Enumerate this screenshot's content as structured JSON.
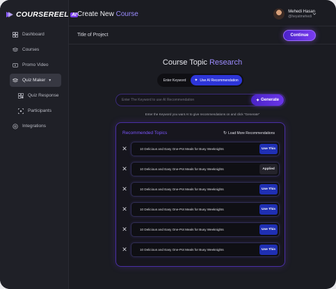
{
  "brand": {
    "name": "COURSEREEL",
    "ai_badge": "AI"
  },
  "sidebar": {
    "items": [
      {
        "label": "Dashboard",
        "icon": "grid-icon"
      },
      {
        "label": "Courses",
        "icon": "stack-icon"
      },
      {
        "label": "Promo Video",
        "icon": "video-icon"
      },
      {
        "label": "Quiz Maker",
        "icon": "quiz-icon"
      },
      {
        "label": "Quiz Response",
        "icon": "response-icon"
      },
      {
        "label": "Participants",
        "icon": "participants-icon"
      },
      {
        "label": "Integrations",
        "icon": "integrations-icon"
      }
    ]
  },
  "header": {
    "title_prefix": "Create New",
    "title_accent": "Course",
    "user_name": "Mehedi Hasan",
    "user_handle": "@heyatmehedi"
  },
  "subheader": {
    "project_title": "Title of Project",
    "continue_label": "Continue"
  },
  "main": {
    "title_prefix": "Course Topic",
    "title_accent": "Research",
    "toggle": {
      "option_keyword": "Enter Keyword",
      "option_ai": "Use AI Recommendation",
      "selected": "Use AI Recommendation"
    },
    "search": {
      "placeholder": "Enter The Keyword to use AI Recommendation",
      "value": ""
    },
    "generate_label": "Generate",
    "hint": "Enter the Keyword you want AI to give recommendations on and click \"Generate\""
  },
  "topics": {
    "title": "Recommended Topics",
    "load_more_label": "Load More Recommendations",
    "items": [
      {
        "text": "10 Delicious and Easy One-Pot Meals for Busy Weeknights",
        "action": "Use This"
      },
      {
        "text": "10 Delicious and Easy One-Pot Meals for Busy Weeknights",
        "action": "Applied"
      },
      {
        "text": "10 Delicious and Easy One-Pot Meals for Busy Weeknights",
        "action": "Use This"
      },
      {
        "text": "10 Delicious and Easy One-Pot Meals for Busy Weeknights",
        "action": "Use This"
      },
      {
        "text": "10 Delicious and Easy One-Pot Meals for Busy Weeknights",
        "action": "Use This"
      },
      {
        "text": "10 Delicious and Easy One-Pot Meals for Busy Weeknights",
        "action": "Use This"
      }
    ]
  },
  "colors": {
    "accent": "#7c56ff",
    "primary_button": "#1f2fb3",
    "background": "#1b1c22"
  }
}
